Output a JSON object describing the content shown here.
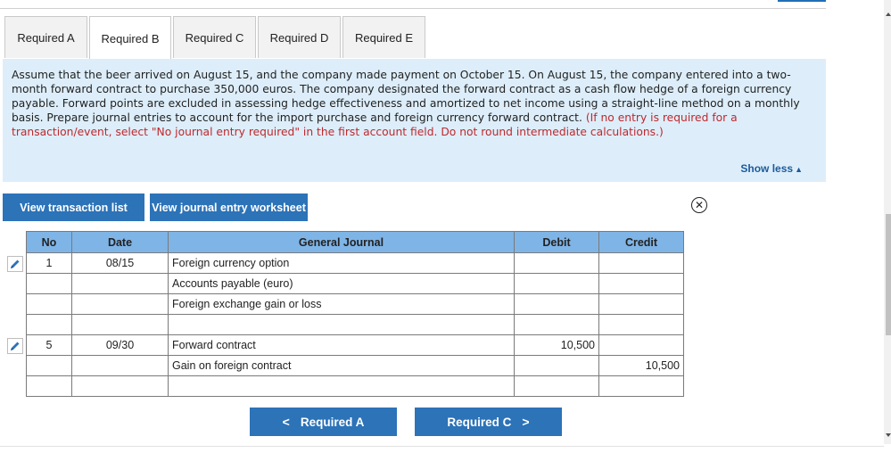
{
  "tabs": [
    "Required A",
    "Required B",
    "Required C",
    "Required D",
    "Required E"
  ],
  "active_tab": "Required B",
  "instructions": {
    "main": "Assume that the beer arrived on August 15, and the company made payment on October 15. On August 15, the company entered into a two-month forward contract to purchase 350,000 euros. The company designated the forward contract as a cash flow hedge of a foreign currency payable. Forward points are excluded in assessing hedge effectiveness and amortized to net income using a straight-line method on a monthly basis. Prepare journal entries to account for the import purchase and foreign currency forward contract.",
    "note": "(If no entry is required for a transaction/event, select \"No journal entry required\" in the first account field. Do not round intermediate calculations.)"
  },
  "show_less": "Show less",
  "buttons": {
    "view_transactions": "View transaction list",
    "view_worksheet": "View journal entry worksheet",
    "prev": "Required A",
    "next": "Required C"
  },
  "journal": {
    "headers": [
      "No",
      "Date",
      "General Journal",
      "Debit",
      "Credit"
    ],
    "rows": [
      {
        "no": "1",
        "date": "08/15",
        "account": "Foreign currency option",
        "debit": "",
        "credit": "",
        "indent": false
      },
      {
        "no": "",
        "date": "",
        "account": "Accounts payable (euro)",
        "debit": "",
        "credit": "",
        "indent": false
      },
      {
        "no": "",
        "date": "",
        "account": "Foreign exchange gain or loss",
        "debit": "",
        "credit": "",
        "indent": false
      },
      {
        "no": "",
        "date": "",
        "account": "",
        "debit": "",
        "credit": "",
        "indent": false
      },
      {
        "no": "5",
        "date": "09/30",
        "account": "Forward contract",
        "debit": "10,500",
        "credit": "",
        "indent": false
      },
      {
        "no": "",
        "date": "",
        "account": "Gain on foreign contract",
        "debit": "",
        "credit": "10,500",
        "indent": true
      },
      {
        "no": "",
        "date": "",
        "account": "",
        "debit": "",
        "credit": "",
        "indent": false
      }
    ]
  },
  "colors": {
    "accent": "#2c73b8",
    "table_header": "#7fb4e6",
    "info_bg": "#ddeefa",
    "note_red": "#c0282d"
  },
  "icons": [
    "pencil-icon",
    "close-circle-icon",
    "chevron-left-icon",
    "chevron-right-icon",
    "triangle-up-icon"
  ]
}
